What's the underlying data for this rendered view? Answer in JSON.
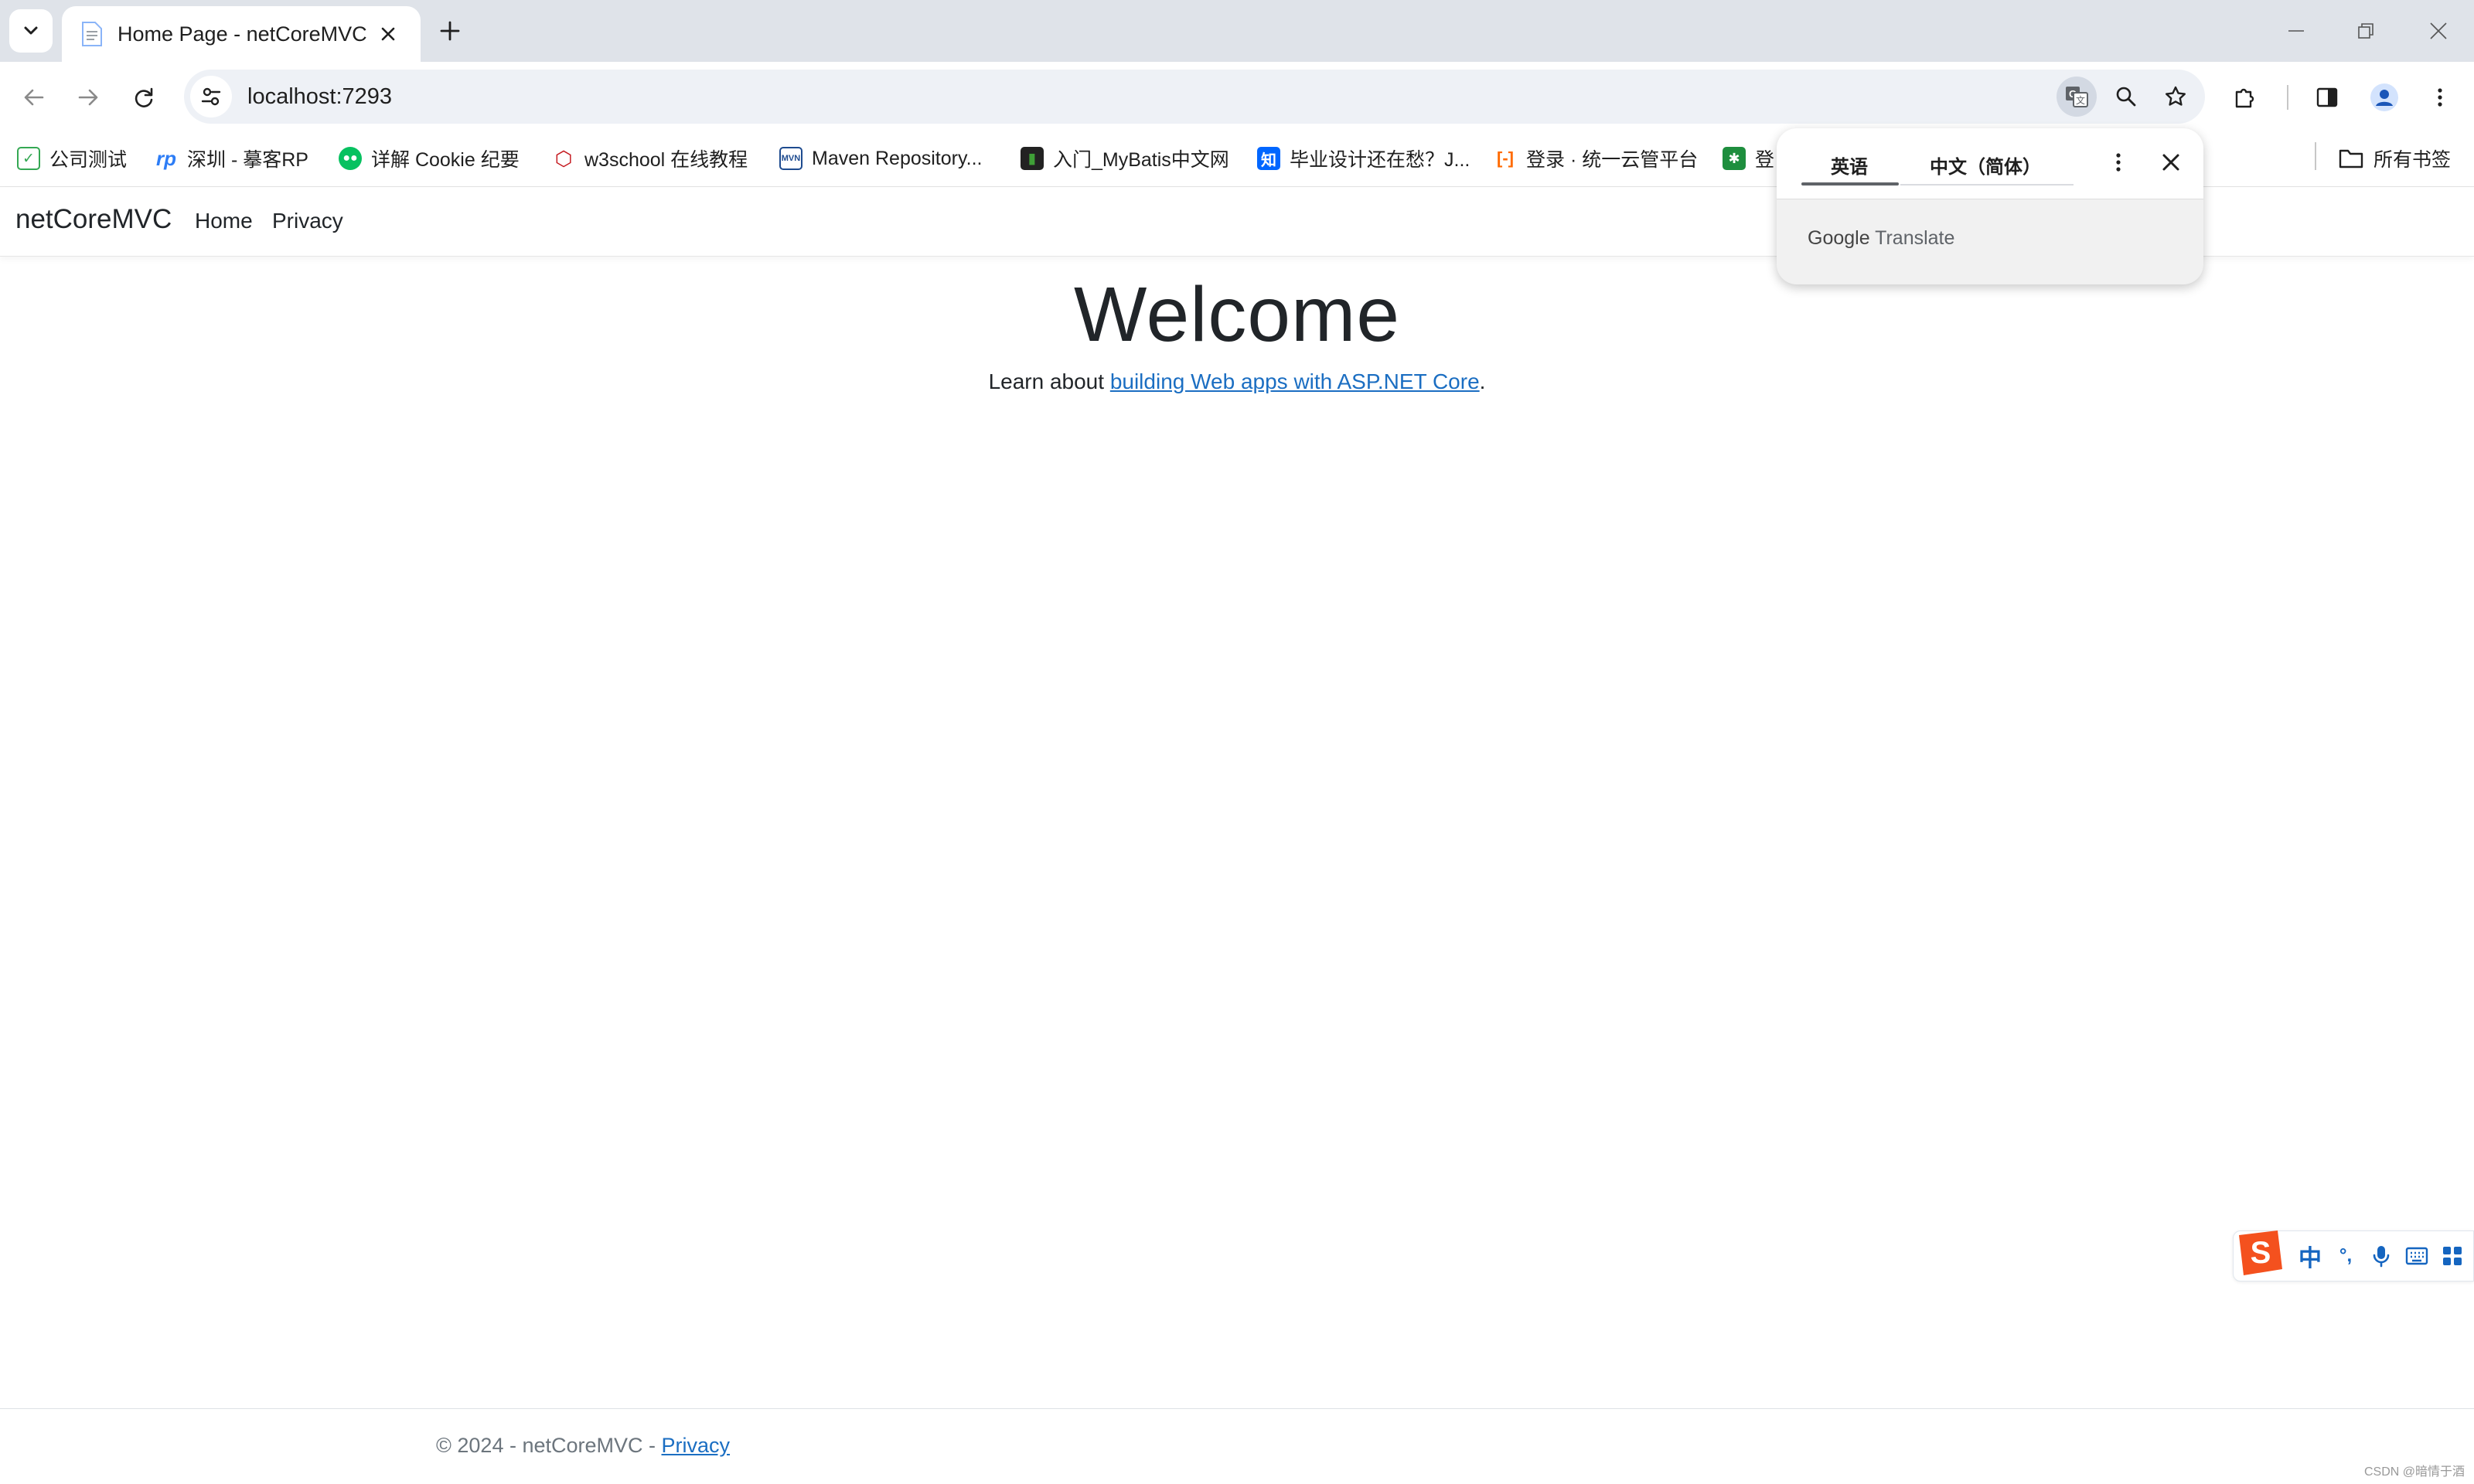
{
  "browser": {
    "tab": {
      "title": "Home Page - netCoreMVC"
    },
    "url": "localhost:7293",
    "bookmarks": [
      {
        "label": "公司测试",
        "icon": "checkbox-file-icon",
        "color": "#34a853"
      },
      {
        "label": "深圳 - 摹客RP",
        "icon": "rp-icon",
        "color": "#2d7df6"
      },
      {
        "label": "详解 Cookie 纪要",
        "icon": "wechat-icon",
        "color": "#07c160"
      },
      {
        "label": "w3school 在线教程",
        "icon": "w3school-icon",
        "color": "#c4161c"
      },
      {
        "label": "Maven Repository...",
        "icon": "mvn-icon",
        "color": "#1e4b8f"
      },
      {
        "label": "入门_MyBatis中文网",
        "icon": "mybatis-icon",
        "color": "#222222"
      },
      {
        "label": "毕业设计还在愁？J...",
        "icon": "zhihu-icon",
        "color": "#0066ff"
      },
      {
        "label": "登录 · 统一云管平台",
        "icon": "aliyun-icon",
        "color": "#ff6a00"
      },
      {
        "label": "登",
        "icon": "grid-app-icon",
        "color": "#1e8e3e"
      }
    ],
    "all_bookmarks_label": "所有书签"
  },
  "site": {
    "brand": "netCoreMVC",
    "nav": [
      "Home",
      "Privacy"
    ],
    "heading": "Welcome",
    "learn_prefix": "Learn about ",
    "learn_link": "building Web apps with ASP.NET Core",
    "learn_suffix": ".",
    "footer_prefix": "© 2024 - netCoreMVC - ",
    "footer_link": "Privacy"
  },
  "translate_popup": {
    "source_lang": "英语",
    "target_lang": "中文（简体）",
    "brand_google": "Google",
    "brand_translate": "Translate"
  },
  "ime": {
    "mode": "中",
    "punct": "°,",
    "logo": "S"
  },
  "watermark": "CSDN @暗情于酒"
}
